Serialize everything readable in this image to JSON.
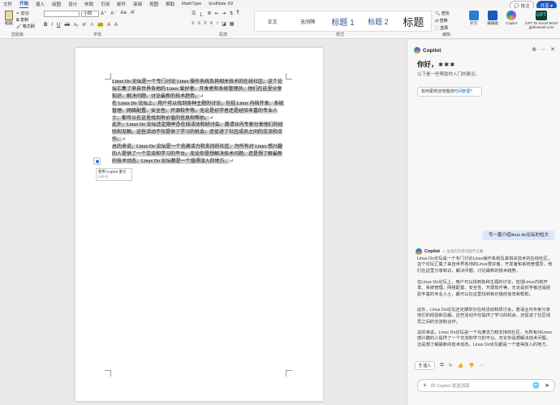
{
  "menu": {
    "tabs": [
      "文件",
      "开始",
      "插入",
      "绘图",
      "设计",
      "布局",
      "引用",
      "邮件",
      "审阅",
      "视图",
      "帮助",
      "MathType",
      "EndNote X9"
    ],
    "active_index": 1,
    "comment_label": "批注",
    "share_label": "共享"
  },
  "ribbon": {
    "clipboard": {
      "paste": "粘贴",
      "cut": "剪切",
      "copy": "复制",
      "format_painter": "格式刷",
      "group_label": "剪贴板"
    },
    "font": {
      "size_value": "小四",
      "group_label": "字体"
    },
    "paragraph": {
      "group_label": "段落"
    },
    "styles": {
      "items": [
        "正文",
        "无间隔",
        "标题 1",
        "标题 2",
        "标题"
      ],
      "group_label": "样式"
    },
    "editing": {
      "find": "查找",
      "replace": "替换",
      "select": "选择",
      "group_label": "编辑"
    },
    "apps": [
      {
        "label": "听写",
        "color": "#2b7cd3"
      },
      {
        "label": "编辑器",
        "color": "#185abd"
      },
      {
        "label": "Copilot",
        "color": "#9b59d0"
      }
    ],
    "gpt": {
      "name": "GPT for Excel Word",
      "site": "gptforwork.com",
      "badge": "GPT"
    }
  },
  "document": {
    "paragraphs": [
      "Linux Do 论坛是一个专门讨论 Linux 操作系统及其相关技术的在线社区。这个论坛汇集了来自世界各地的 Linux 爱好者、开发者和系统管理员，他们在这里分享知识、解决问题、讨论最新的技术趋势。",
      "在 Linux Do 论坛上，用户可以找到各种主题的讨论，包括 Linux 内核开发、系统管理、网络配置、安全性、开源软件等。无论是初学者还是经验丰富的专业人士，都可以在这里找到有价值的信息和帮助。",
      "此外，Linux Do 论坛还定期举办在线活动和研讨会，邀请业内专家分享他们的经验和见解。这些活动不仅提供了学习的机会，还促进了社区成员之间的交流和合作。",
      "总的来说，Linux Do 论坛是一个充满活力和支持的社区，为所有对 Linux 感兴趣的人提供了一个交流和学习的平台。无论你是想解决技术问题，还是想了解最新的技术动态，Linux Do 论坛都是一个值得加入的地方。"
    ],
    "tooltip_title": "使用 Copilot 重写",
    "tooltip_shortcut": "(Alt+I)"
  },
  "copilot": {
    "title": "Copilot",
    "greeting": "你好，∗∗∗",
    "subtitle": "以下是一些帮助你入门的建议。",
    "suggestion_prefix": "如何更简洁地描述",
    "suggestion_link": "时间管理?",
    "user_message": "写一篇介绍linux do论坛的短文",
    "response_name": "Copilot",
    "response_note": "⚠ 生成的内容可能不正确",
    "response_paragraphs": [
      "Linux Do论坛是一个专门讨论Linux操作系统及其相关技术的在线社区。这个论坛汇集了来自世界各地的Linux爱好者、开发者和系统管理员，他们在这里分享知识、解决问题、讨论最新的技术趋势。",
      "在Linux Do论坛上，用户可以找到各种主题的讨论，包括Linux内核开发、系统管理、网络配置、安全性、开源软件等。无论是初学者还是经验丰富的专业人士，都可以在这里找到有价值的信息和帮助。",
      "此外，Linux Do论坛还定期举办在线活动和研讨会，邀请业内专家分享他们的经验和见解。这些活动不仅提供了学习的机会，还促进了社区成员之间的交流和合作。",
      "总的来说，Linux Do论坛是一个充满活力和支持的社区，为所有对Linux感兴趣的人提供了一个交流和学习的平台。无论你是想解决技术问题，还是想了解最新的技术动态，Linux Do论坛都是一个值得加入的地方。"
    ],
    "insert_label": "插入",
    "input_placeholder": "向 Copilot 发送消息"
  }
}
